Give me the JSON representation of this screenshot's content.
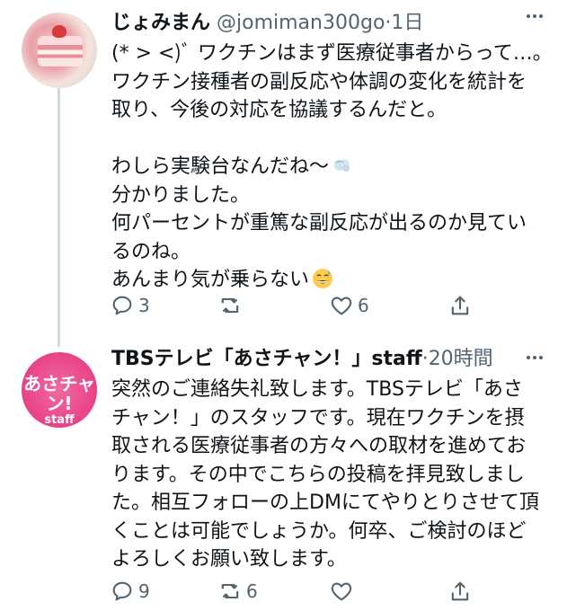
{
  "tweets": [
    {
      "name": "じょみまん",
      "handle": "@jomiman300go",
      "time": "1日",
      "body_lines": [
        "(* > <)ﾞ ワクチンはまず医療従事者からって…。",
        "ワクチン接種者の副反応や体調の変化を統計を",
        "取り、今後の対応を協議するんだと。",
        "",
        "わしら実験台なんだね〜",
        "分かりました。",
        "何パーセントが重篤な副反応が出るのか見てい",
        "るのね。",
        "あんまり気が乗らない"
      ],
      "reply_count": "3",
      "retweet_count": "",
      "like_count": "6",
      "share_count": ""
    },
    {
      "name": "TBSテレビ「あさチャン！」staff",
      "handle": "",
      "time": "20時間",
      "avatar_text": "あさチャン!",
      "avatar_subtext": "staff",
      "body_lines": [
        "突然のご連絡失礼致します。TBSテレビ「あさ",
        "チャン！」のスタッフです。現在ワクチンを摂",
        "取される医療従事者の方々への取材を進めてお",
        "ります。その中でこちらの投稿を拝見致しまし",
        "た。相互フォローの上DMにてやりとりさせて頂",
        "くことは可能でしょうか。何卒、ご検討のほど",
        "よろしくお願い致します。"
      ],
      "reply_count": "9",
      "retweet_count": "6",
      "like_count": "",
      "share_count": ""
    }
  ],
  "separator": "·",
  "icons": {
    "reply": "reply-icon",
    "retweet": "retweet-icon",
    "like": "heart-icon",
    "share": "share-icon",
    "more": "more-icon",
    "emoji_sigh": "dash-emoji-icon",
    "emoji_sweat": "sweat-smile-emoji-icon"
  },
  "colors": {
    "text": "#0f1419",
    "secondary": "#536471",
    "thread_line": "#cfd9de",
    "brand_pink": "#e94287"
  }
}
